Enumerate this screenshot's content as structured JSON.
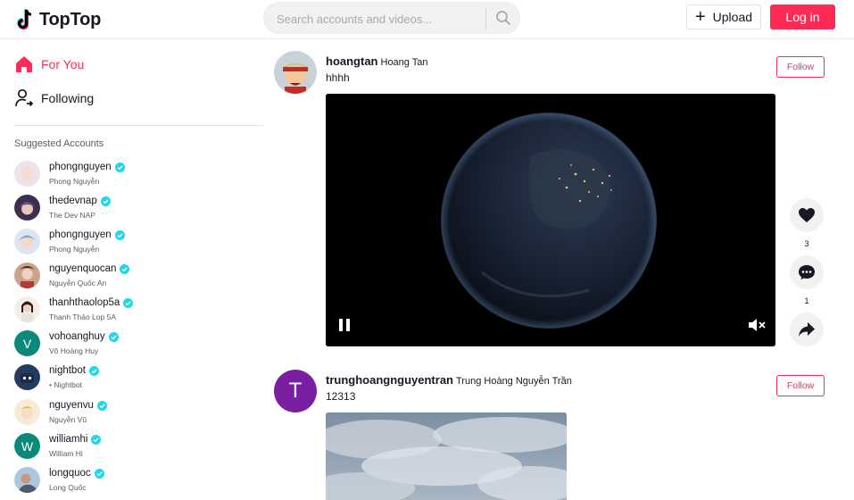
{
  "header": {
    "logo_text": "TopTop",
    "search_placeholder": "Search accounts and videos...",
    "upload_label": "Upload",
    "login_label": "Log in"
  },
  "sidebar": {
    "nav": [
      {
        "label": "For You",
        "icon": "home-icon",
        "active": true
      },
      {
        "label": "Following",
        "icon": "following-icon",
        "active": false
      }
    ],
    "suggested_title": "Suggested Accounts",
    "accounts": [
      {
        "username": "phongnguyen",
        "nickname": "Phong Nguyễn",
        "avatar": "anime-avatar-icon"
      },
      {
        "username": "thedevnap",
        "nickname": "The Dev NAP",
        "avatar": "anime-avatar-icon"
      },
      {
        "username": "phongnguyen",
        "nickname": "Phong Nguyễn",
        "avatar": "anime-avatar-icon"
      },
      {
        "username": "nguyenquocan",
        "nickname": "Nguyễn Quốc An",
        "avatar": "photo-avatar-icon"
      },
      {
        "username": "thanhthaolop5a",
        "nickname": "Thanh Thảo Lop 5A",
        "avatar": "photo-avatar-icon"
      },
      {
        "username": "vohoanghuy",
        "nickname": "Võ Hoàng Huy",
        "avatar_letter": "V",
        "avatar_color": "#0b8a7c"
      },
      {
        "username": "nightbot",
        "nickname": "• Nightbot",
        "avatar": "bot-avatar-icon"
      },
      {
        "username": "nguyenvu",
        "nickname": "Nguyễn Vũ",
        "avatar": "anime-avatar-icon"
      },
      {
        "username": "williamhi",
        "nickname": "William Hi",
        "avatar_letter": "W",
        "avatar_color": "#0b8a7c"
      },
      {
        "username": "longquoc",
        "nickname": "Long Quốc",
        "avatar": "photo-avatar-icon"
      }
    ]
  },
  "feed": [
    {
      "username": "hoangtan",
      "nickname": "Hoang Tan",
      "caption": "hhhh",
      "follow_label": "Follow",
      "likes": "3",
      "comments": "1"
    },
    {
      "username": "trunghoangnguyentran",
      "nickname": "Trung Hoàng Nguyễn Trần",
      "caption": "12313",
      "follow_label": "Follow",
      "avatar_letter": "T",
      "avatar_color": "#7b1fa2"
    }
  ],
  "colors": {
    "accent": "#fe2c55",
    "verified": "#20d5ec",
    "text": "#161823"
  }
}
